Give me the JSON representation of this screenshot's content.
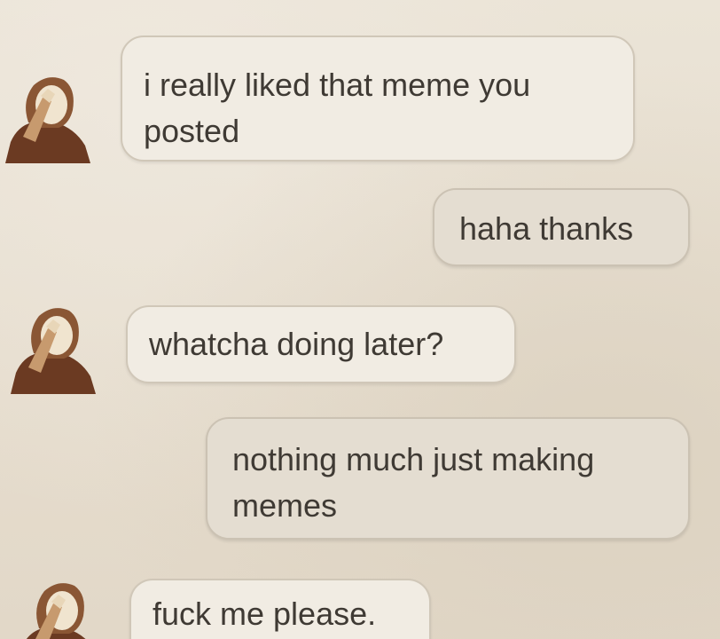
{
  "conversation": {
    "messages": [
      {
        "sender": "contact",
        "text": "i really liked that meme you\nposted"
      },
      {
        "sender": "me",
        "text": "haha thanks"
      },
      {
        "sender": "contact",
        "text": "whatcha doing later?"
      },
      {
        "sender": "me",
        "text": "nothing much just making\nmemes"
      },
      {
        "sender": "contact",
        "text": "fuck me please."
      }
    ]
  },
  "colors": {
    "background": "#e8dfd0",
    "incoming_bubble": "#f1ece3",
    "outgoing_bubble": "#e4ddd1",
    "bubble_border": "#d0c7b8",
    "text": "#3f3a34"
  },
  "icons": {
    "contact_avatar": "contact-avatar-icon"
  }
}
